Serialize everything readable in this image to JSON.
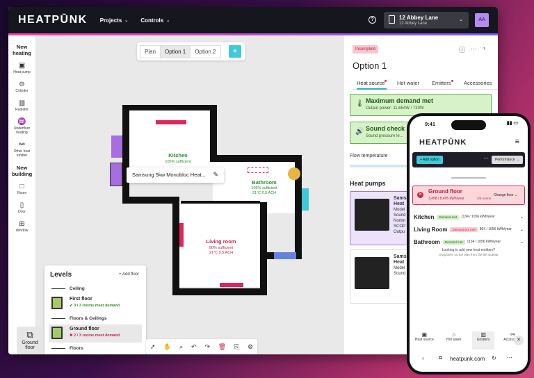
{
  "app": {
    "logo": "HEATPŪNK",
    "menus": [
      "Projects",
      "Controls"
    ],
    "project_title": "12 Abbey Lane",
    "project_sub": "12 Abbey Lane",
    "avatar": "AA"
  },
  "sidebar": {
    "new_heating": "New heating",
    "heating_items": [
      {
        "label": "Heat pump",
        "icon": "heat-pump-icon",
        "glyph": "▣"
      },
      {
        "label": "Cylinder",
        "icon": "cylinder-icon",
        "glyph": "⊖"
      },
      {
        "label": "Radiator",
        "icon": "radiator-icon",
        "glyph": "▥"
      },
      {
        "label": "Underfloor heating",
        "icon": "underfloor-icon",
        "glyph": "♒"
      },
      {
        "label": "Other heat emitter",
        "icon": "other-emitter-icon",
        "glyph": "⚯"
      }
    ],
    "new_building": "New building",
    "building_items": [
      {
        "label": "Room",
        "icon": "room-icon",
        "glyph": "□"
      },
      {
        "label": "Door",
        "icon": "door-icon",
        "glyph": "▯"
      },
      {
        "label": "Window",
        "icon": "window-icon",
        "glyph": "⊞"
      }
    ],
    "ground_floor": "Ground floor"
  },
  "options": {
    "tabs": [
      "Plan",
      "Option 1",
      "Option 2"
    ],
    "selected": "Option 1",
    "add": "+"
  },
  "rooms": {
    "kitchen": {
      "name": "Kitchen",
      "status": "105% sufficient"
    },
    "bathroom": {
      "name": "Bathroom",
      "status": "105% sufficient",
      "detail": "21°C  0.5 ACH"
    },
    "living": {
      "name": "Living room",
      "status": "80% sufficient",
      "detail": "21°C  0.5 ACH"
    }
  },
  "tooltip": "Samsung 5kw Monobloc Heat...",
  "levels": {
    "title": "Levels",
    "add": "+ Add floor",
    "ceiling": "Ceiling",
    "first_floor": {
      "name": "First floor",
      "status": "3 / 3 rooms meet demand",
      "color": "#2a8a2a"
    },
    "floors_ceilings": "Floors & Ceilings",
    "ground_floor": {
      "name": "Ground floor",
      "status": "2 / 3 rooms meet demand",
      "color": "#c81e46"
    },
    "floors": "Floors"
  },
  "panel": {
    "badge": "Incomplete",
    "title": "Option 1",
    "tabs": [
      "Heat source",
      "Hot water",
      "Emitters",
      "Accessories"
    ],
    "demand": {
      "title": "Maximum demand met",
      "sub": "Output power: 11,654W / 730W"
    },
    "sound": {
      "title": "Sound check",
      "sub": "Sound pressure le..."
    },
    "flow_temp": "Flow temperature",
    "heat_pumps": "Heat pumps",
    "hp1": [
      "Sams",
      "Heat",
      "Model",
      "Sound",
      "Nomin",
      "SCOP",
      "Outpu"
    ],
    "hp2": [
      "Sams",
      "Heat",
      "Model",
      "Sound"
    ]
  },
  "phone": {
    "time": "9:41",
    "logo": "HEATPŪNK",
    "add_option": "+ Add option",
    "performance": "Performance →",
    "ground_floor": {
      "name": "Ground floor",
      "sub": "3,458 / 8,495 kWh/year",
      "rooms": "2/3 rooms",
      "change": "Change floor ⌄"
    },
    "rooms": [
      {
        "name": "Kitchen",
        "pill": "Demand met",
        "kind": "g",
        "kw": "1134 / 1056 kWh/year"
      },
      {
        "name": "Living Room",
        "pill": "Demand not met",
        "kind": "r",
        "kw": "804 / 1056 kWh/year"
      },
      {
        "name": "Bathroom",
        "pill": "Demand met",
        "kind": "g",
        "kw": "1134 / 1056 kWh/year"
      }
    ],
    "hint1": "Looking to add new heat emitters?",
    "hint2": "Drag them on the plan from the left sidebar",
    "nav": [
      "Heat source",
      "Hot water",
      "Emitters",
      "Accessories"
    ],
    "url": "heatpunk.com"
  }
}
